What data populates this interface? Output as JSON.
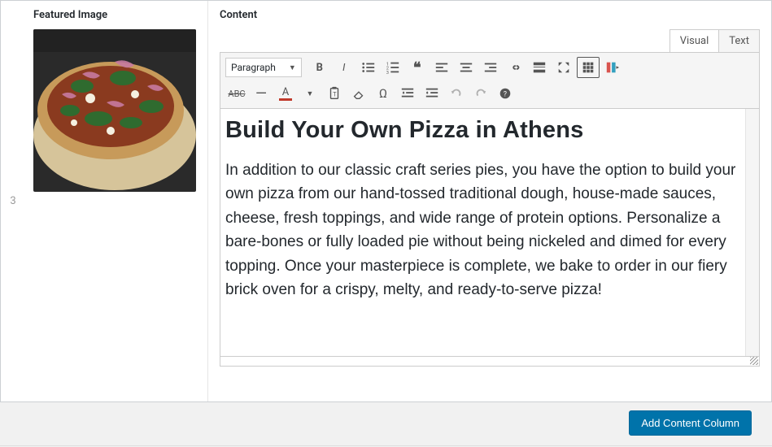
{
  "row_index": "3",
  "left": {
    "label": "Featured Image"
  },
  "right": {
    "label": "Content",
    "tabs": {
      "visual": "Visual",
      "text": "Text"
    }
  },
  "toolbar": {
    "format_selector": "Paragraph"
  },
  "content": {
    "heading": "Build Your Own Pizza in Athens",
    "body": "In addition to our classic craft series pies, you have the option to build your own pizza from our hand-tossed traditional dough, house-made sauces, cheese, fresh toppings, and wide range of protein options. Personalize a bare-bones or fully loaded pie without being nickeled and dimed for every topping. Once your masterpiece is complete, we bake to order in our fiery brick oven for a crispy, melty, and ready-to-serve pizza!"
  },
  "footer": {
    "add_column": "Add Content Column"
  }
}
